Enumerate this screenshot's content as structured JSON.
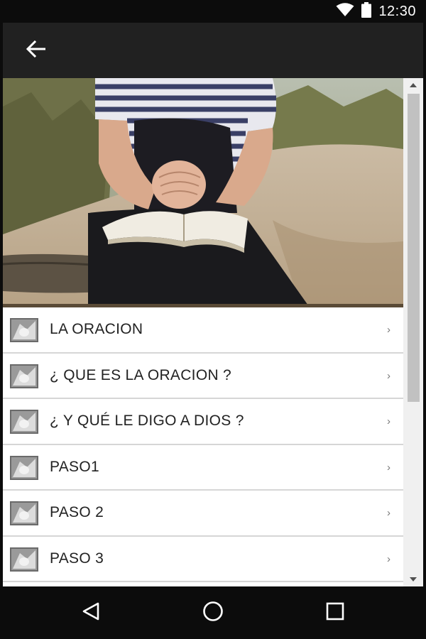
{
  "status_bar": {
    "time": "12:30",
    "icons": [
      "wifi-icon",
      "battery-icon"
    ]
  },
  "app_bar": {
    "back_icon": "arrow-left-icon"
  },
  "hero": {
    "description_icon": "hero-image"
  },
  "list": {
    "items": [
      {
        "label": "LA ORACION",
        "chevron": "›"
      },
      {
        "label": "¿ QUE ES LA ORACION ?",
        "chevron": "›"
      },
      {
        "label": "¿ Y QUÉ LE DIGO A DIOS ?",
        "chevron": "›"
      },
      {
        "label": "PASO1",
        "chevron": "›"
      },
      {
        "label": "PASO 2",
        "chevron": "›"
      },
      {
        "label": "PASO 3",
        "chevron": "›"
      }
    ]
  },
  "nav_bar": {
    "icons": [
      "back-triangle-icon",
      "home-circle-icon",
      "recents-square-icon"
    ]
  },
  "colors": {
    "app_bar": "#212121",
    "status_bar": "#0c0c0c",
    "list_bg": "#ffffff",
    "divider": "#d6d6d6"
  }
}
